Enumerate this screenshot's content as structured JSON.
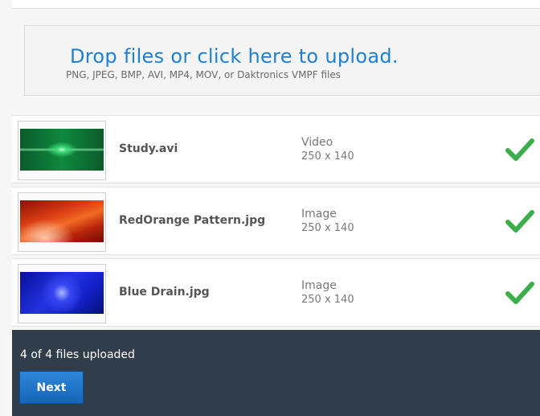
{
  "upload": {
    "title": "Drop files or click here to upload.",
    "subtitle": "PNG, JPEG, BMP, AVI, MP4, MOV, or Daktronics VMPF files"
  },
  "files": [
    {
      "name": "Study.avi",
      "type": "Video",
      "dims": "250 x 140",
      "status_icon": "check-icon",
      "thumb": "green"
    },
    {
      "name": "RedOrange Pattern.jpg",
      "type": "Image",
      "dims": "250 x 140",
      "status_icon": "check-icon",
      "thumb": "red"
    },
    {
      "name": "Blue Drain.jpg",
      "type": "Image",
      "dims": "250 x 140",
      "status_icon": "check-icon",
      "thumb": "blue"
    }
  ],
  "footer": {
    "status": "4 of 4 files uploaded",
    "next_label": "Next"
  },
  "colors": {
    "accent": "#1f7fd1",
    "success": "#3dae4b",
    "footer_bg": "#303d4b"
  }
}
